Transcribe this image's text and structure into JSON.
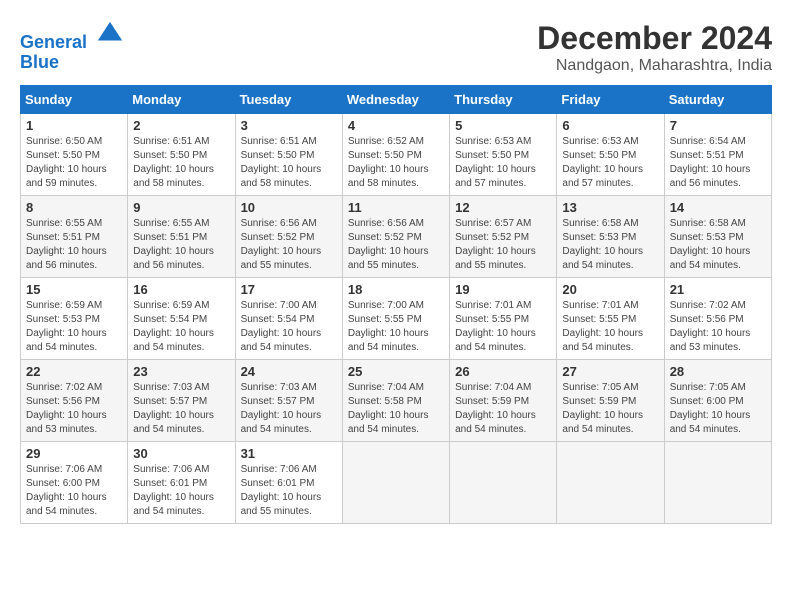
{
  "logo": {
    "line1": "General",
    "line2": "Blue"
  },
  "title": "December 2024",
  "location": "Nandgaon, Maharashtra, India",
  "days_of_week": [
    "Sunday",
    "Monday",
    "Tuesday",
    "Wednesday",
    "Thursday",
    "Friday",
    "Saturday"
  ],
  "weeks": [
    [
      {
        "day": "1",
        "sunrise": "6:50 AM",
        "sunset": "5:50 PM",
        "daylight": "10 hours and 59 minutes."
      },
      {
        "day": "2",
        "sunrise": "6:51 AM",
        "sunset": "5:50 PM",
        "daylight": "10 hours and 58 minutes."
      },
      {
        "day": "3",
        "sunrise": "6:51 AM",
        "sunset": "5:50 PM",
        "daylight": "10 hours and 58 minutes."
      },
      {
        "day": "4",
        "sunrise": "6:52 AM",
        "sunset": "5:50 PM",
        "daylight": "10 hours and 58 minutes."
      },
      {
        "day": "5",
        "sunrise": "6:53 AM",
        "sunset": "5:50 PM",
        "daylight": "10 hours and 57 minutes."
      },
      {
        "day": "6",
        "sunrise": "6:53 AM",
        "sunset": "5:50 PM",
        "daylight": "10 hours and 57 minutes."
      },
      {
        "day": "7",
        "sunrise": "6:54 AM",
        "sunset": "5:51 PM",
        "daylight": "10 hours and 56 minutes."
      }
    ],
    [
      {
        "day": "8",
        "sunrise": "6:55 AM",
        "sunset": "5:51 PM",
        "daylight": "10 hours and 56 minutes."
      },
      {
        "day": "9",
        "sunrise": "6:55 AM",
        "sunset": "5:51 PM",
        "daylight": "10 hours and 56 minutes."
      },
      {
        "day": "10",
        "sunrise": "6:56 AM",
        "sunset": "5:52 PM",
        "daylight": "10 hours and 55 minutes."
      },
      {
        "day": "11",
        "sunrise": "6:56 AM",
        "sunset": "5:52 PM",
        "daylight": "10 hours and 55 minutes."
      },
      {
        "day": "12",
        "sunrise": "6:57 AM",
        "sunset": "5:52 PM",
        "daylight": "10 hours and 55 minutes."
      },
      {
        "day": "13",
        "sunrise": "6:58 AM",
        "sunset": "5:53 PM",
        "daylight": "10 hours and 54 minutes."
      },
      {
        "day": "14",
        "sunrise": "6:58 AM",
        "sunset": "5:53 PM",
        "daylight": "10 hours and 54 minutes."
      }
    ],
    [
      {
        "day": "15",
        "sunrise": "6:59 AM",
        "sunset": "5:53 PM",
        "daylight": "10 hours and 54 minutes."
      },
      {
        "day": "16",
        "sunrise": "6:59 AM",
        "sunset": "5:54 PM",
        "daylight": "10 hours and 54 minutes."
      },
      {
        "day": "17",
        "sunrise": "7:00 AM",
        "sunset": "5:54 PM",
        "daylight": "10 hours and 54 minutes."
      },
      {
        "day": "18",
        "sunrise": "7:00 AM",
        "sunset": "5:55 PM",
        "daylight": "10 hours and 54 minutes."
      },
      {
        "day": "19",
        "sunrise": "7:01 AM",
        "sunset": "5:55 PM",
        "daylight": "10 hours and 54 minutes."
      },
      {
        "day": "20",
        "sunrise": "7:01 AM",
        "sunset": "5:55 PM",
        "daylight": "10 hours and 54 minutes."
      },
      {
        "day": "21",
        "sunrise": "7:02 AM",
        "sunset": "5:56 PM",
        "daylight": "10 hours and 53 minutes."
      }
    ],
    [
      {
        "day": "22",
        "sunrise": "7:02 AM",
        "sunset": "5:56 PM",
        "daylight": "10 hours and 53 minutes."
      },
      {
        "day": "23",
        "sunrise": "7:03 AM",
        "sunset": "5:57 PM",
        "daylight": "10 hours and 54 minutes."
      },
      {
        "day": "24",
        "sunrise": "7:03 AM",
        "sunset": "5:57 PM",
        "daylight": "10 hours and 54 minutes."
      },
      {
        "day": "25",
        "sunrise": "7:04 AM",
        "sunset": "5:58 PM",
        "daylight": "10 hours and 54 minutes."
      },
      {
        "day": "26",
        "sunrise": "7:04 AM",
        "sunset": "5:59 PM",
        "daylight": "10 hours and 54 minutes."
      },
      {
        "day": "27",
        "sunrise": "7:05 AM",
        "sunset": "5:59 PM",
        "daylight": "10 hours and 54 minutes."
      },
      {
        "day": "28",
        "sunrise": "7:05 AM",
        "sunset": "6:00 PM",
        "daylight": "10 hours and 54 minutes."
      }
    ],
    [
      {
        "day": "29",
        "sunrise": "7:06 AM",
        "sunset": "6:00 PM",
        "daylight": "10 hours and 54 minutes."
      },
      {
        "day": "30",
        "sunrise": "7:06 AM",
        "sunset": "6:01 PM",
        "daylight": "10 hours and 54 minutes."
      },
      {
        "day": "31",
        "sunrise": "7:06 AM",
        "sunset": "6:01 PM",
        "daylight": "10 hours and 55 minutes."
      },
      null,
      null,
      null,
      null
    ]
  ]
}
